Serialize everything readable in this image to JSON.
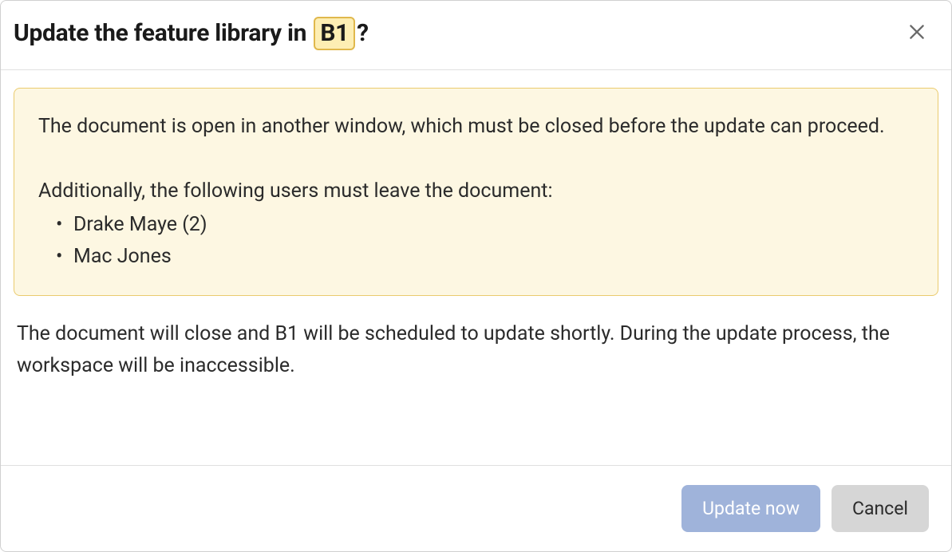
{
  "header": {
    "title_prefix": "Update the feature library in",
    "badge": "B1",
    "title_suffix": "?"
  },
  "warning": {
    "main_message": "The document is open in another window, which must be closed before the update can proceed.",
    "users_heading": "Additionally, the following users must leave the document:",
    "users": [
      "Drake Maye (2)",
      "Mac Jones"
    ]
  },
  "body": {
    "explanation": "The document will close and B1 will be scheduled to update shortly. During the update process, the workspace will be inaccessible."
  },
  "footer": {
    "primary_label": "Update now",
    "secondary_label": "Cancel"
  }
}
